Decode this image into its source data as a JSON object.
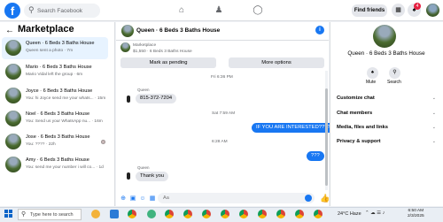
{
  "topbar": {
    "search_placeholder": "Search Facebook",
    "find_friends": "Find friends",
    "notification_count": "4"
  },
  "sidebar": {
    "title": "Marketplace",
    "conversations": [
      {
        "title": "Queen · 6 Beds 3 Baths House",
        "sub": "Queen sent a photo · 7m"
      },
      {
        "title": "Mario · 6 Beds 3 Baths House",
        "sub": "Mario Vidal left the group · 6m"
      },
      {
        "title": "Joyce · 6 Beds 3 Baths House",
        "sub": "You: hi Joyce send me your whats... · 15m"
      },
      {
        "title": "Noel · 6 Beds 3 Baths House",
        "sub": "You: Send us your WhatsApp nu... · 16m"
      },
      {
        "title": "Jose · 6 Beds 3 Baths House",
        "sub": "You: ???? · 22h"
      },
      {
        "title": "Amy · 6 Beds 3 Baths House",
        "sub": "You: send me your number i will co... · 1d"
      }
    ]
  },
  "chat": {
    "title": "Queen · 6 Beds 3 Baths House",
    "listing_label": "Marketplace",
    "listing_price": "$1,550 · 6 Beds 3 Baths House",
    "mark_pending": "Mark as pending",
    "more_options": "More options",
    "messages": [
      {
        "type": "ts",
        "text": "Fri 6:36 PM"
      },
      {
        "type": "in",
        "sender": "Queen",
        "text": "815-372-7204"
      },
      {
        "type": "ts",
        "text": "Sat 7:59 AM"
      },
      {
        "type": "out",
        "text": "IF YOU ARE INTERESTED????"
      },
      {
        "type": "ts",
        "text": "6:28 AM"
      },
      {
        "type": "out",
        "text": "???"
      },
      {
        "type": "in",
        "sender": "Queen",
        "text": "Thank you"
      }
    ],
    "composer_placeholder": "Aa"
  },
  "rpanel": {
    "title": "Queen · 6 Beds 3 Baths House",
    "mute": "Mute",
    "search": "Search",
    "rows": [
      "Customize chat",
      "Chat members",
      "Media, files and links",
      "Privacy & support"
    ]
  },
  "taskbar": {
    "search_text": "Type here to search",
    "weather": "24°C  Haze",
    "time": "6:50 AM",
    "date": "2/3/2025"
  }
}
